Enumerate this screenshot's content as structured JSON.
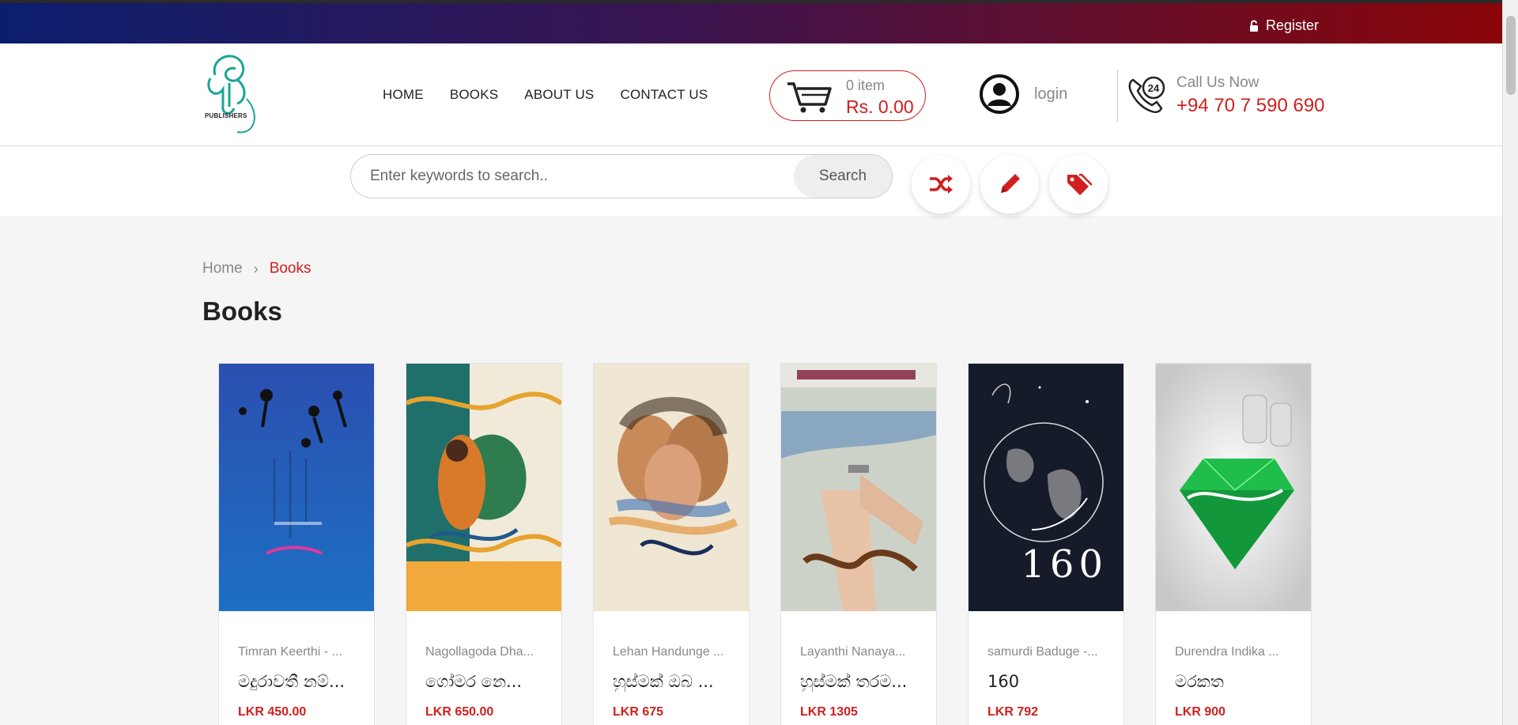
{
  "topbar": {
    "register_label": "Register"
  },
  "header": {
    "logo_text": "PUBLISHERS",
    "nav": [
      "HOME",
      "BOOKS",
      "ABOUT US",
      "CONTACT US"
    ],
    "cart": {
      "count": "0 item",
      "total": "Rs. 0.00"
    },
    "login_label": "login",
    "call_label": "Call Us Now",
    "call_phone": "+94 70 7 590 690"
  },
  "search": {
    "placeholder": "Enter keywords to search..",
    "button_label": "Search"
  },
  "quick_actions": [
    "shuffle-icon",
    "pencil-icon",
    "tags-icon"
  ],
  "colors": {
    "accent": "#d11f1f",
    "gradient_start": "#0b1e6e",
    "gradient_end": "#8a0508"
  },
  "breadcrumb": {
    "home": "Home",
    "current": "Books"
  },
  "page_title": "Books",
  "books": [
    {
      "author": "Timran Keerthi - ...",
      "title": "මදුරාවතී නම්...",
      "price": "LKR 450.00"
    },
    {
      "author": "Nagollagoda Dha...",
      "title": "ගෝමර නෙ...",
      "price": "LKR 650.00"
    },
    {
      "author": "Lehan Handunge ...",
      "title": "හුස්මක් ඔබ ...",
      "price": "LKR 675"
    },
    {
      "author": "Layanthi Nanaya...",
      "title": "හුස්මක් තරම...",
      "price": "LKR 1305"
    },
    {
      "author": "samurdi Baduge -...",
      "title": "160",
      "price": "LKR 792"
    },
    {
      "author": "Durendra Indika ...",
      "title": "මරකත",
      "price": "LKR 900"
    }
  ]
}
